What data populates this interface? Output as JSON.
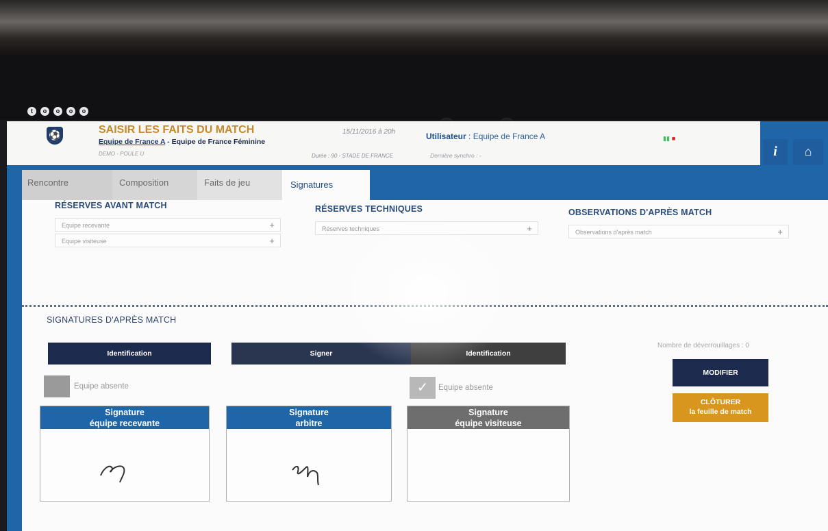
{
  "app": {
    "title": "SAISIR LES FAITS DU MATCH",
    "home_team": "Equipe de France A",
    "separator": " - ",
    "away_team": "Equipe de France Féminine",
    "competition": "DEMO - POULE U",
    "date": "15/11/2016 à 20h",
    "duration_venue": "Durée : 90 - STADE DE FRANCE",
    "user_label": "Utilisateur",
    "user_value": " : Equipe de France A",
    "sync_label": "Dernière synchro : -",
    "info_glyph": "i",
    "home_glyph": "⌂"
  },
  "tabs": [
    "Rencontre",
    "Composition",
    "Faits de jeu",
    "Signatures"
  ],
  "active_tab": "Signatures",
  "reserves_avant": {
    "title": "RÉSERVES AVANT MATCH",
    "fields": [
      {
        "placeholder": "Equipe recevante",
        "icon": "+"
      },
      {
        "placeholder": "Equipe visiteuse",
        "icon": "+"
      }
    ]
  },
  "reserves_tech": {
    "title": "RÉSERVES TECHNIQUES",
    "placeholder": "Réserves techniques",
    "icon": "+"
  },
  "observations": {
    "title": "OBSERVATIONS D'APRÈS MATCH",
    "placeholder": "Observations d'après match",
    "icon": "+"
  },
  "signatures": {
    "title": "SIGNATURES D'APRÈS MATCH",
    "buttons": [
      "Identification",
      "Signer",
      "Identification"
    ],
    "absent_label": "Equipe absente",
    "boxes": [
      {
        "line1": "Signature",
        "line2": "équipe recevante"
      },
      {
        "line1": "Signature",
        "line2": "arbitre"
      },
      {
        "line1": "Signature",
        "line2": "équipe visiteuse"
      }
    ],
    "unlock_count": "Nombre de déverrouillages : 0",
    "modifier": "MODIFIER",
    "cloturer_line1": "CLÔTURER",
    "cloturer_line2": "la feuille de match"
  },
  "colors": {
    "navy": "#1c2a4d",
    "blue": "#1f66a8",
    "gray_header": "#6e6e6e",
    "gold": "#d9961f",
    "title_gold": "#c58a2a"
  }
}
